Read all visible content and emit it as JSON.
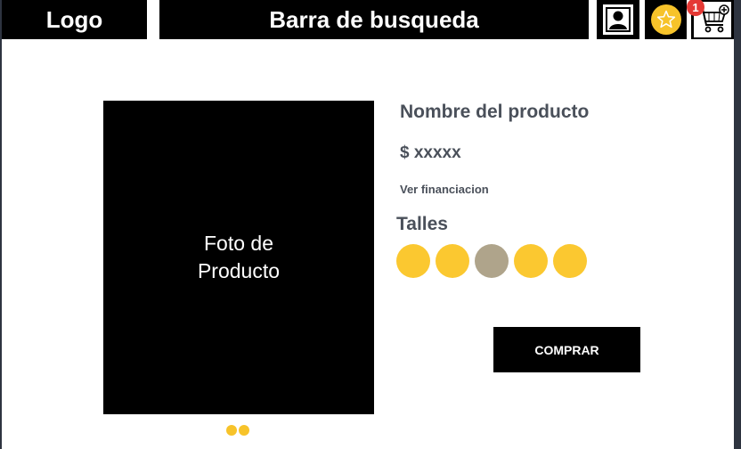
{
  "header": {
    "logo": "Logo",
    "search": "Barra de busqueda",
    "cart_count": "1",
    "icons": [
      "user-icon",
      "star-icon",
      "cart-icon"
    ]
  },
  "product": {
    "photo_label": "Foto de Producto",
    "name": "Nombre del producto",
    "price": "$ xxxxx",
    "financing_link": "Ver financiacion",
    "sizes_title": "Talles",
    "size_count": 5,
    "selected_size_index": 2,
    "image_dots": 2,
    "buy_label": "COMPRAR"
  },
  "colors": {
    "accent": "#fbc830",
    "selected_size": "#afa48b",
    "badge": "#e53935",
    "text": "#4a505a"
  }
}
